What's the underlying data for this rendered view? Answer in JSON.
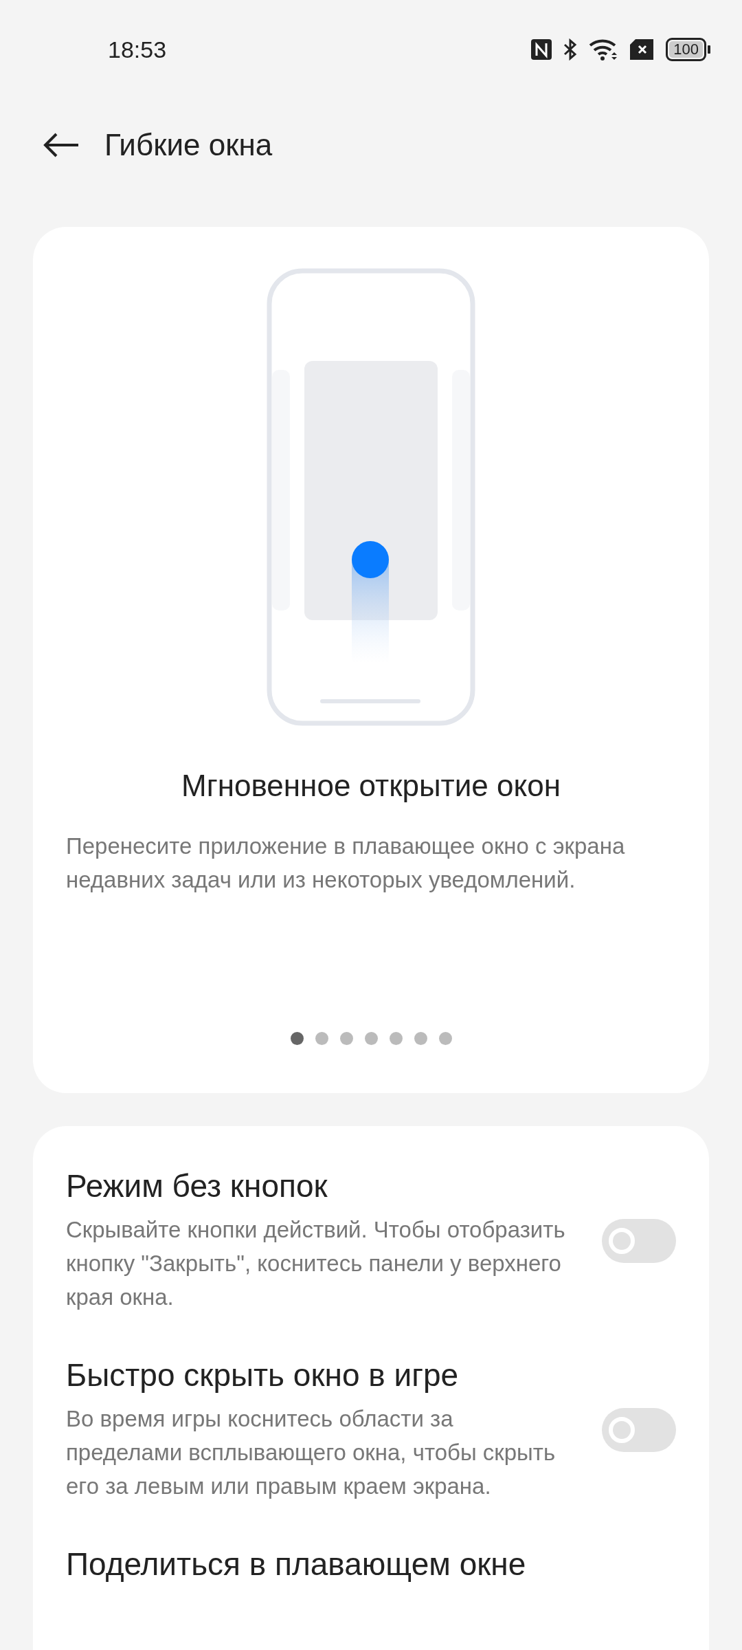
{
  "status_bar": {
    "time": "18:53",
    "battery": "100"
  },
  "header": {
    "title": "Гибкие окна"
  },
  "intro_card": {
    "heading": "Мгновенное открытие окон",
    "description": "Перенесите приложение в плавающее окно с экрана недавних задач или из некоторых уведомлений.",
    "pages": [
      {
        "selected": true
      },
      {
        "selected": false
      },
      {
        "selected": false
      },
      {
        "selected": false
      },
      {
        "selected": false
      },
      {
        "selected": false
      },
      {
        "selected": false
      }
    ]
  },
  "settings": [
    {
      "title": "Режим без кнопок",
      "description": "Скрывайте кнопки действий. Чтобы отобразить кнопку \"Закрыть\", коснитесь панели у верхнего края окна.",
      "on": false
    },
    {
      "title": "Быстро скрыть окно в игре",
      "description": "Во время игры коснитесь области за пределами всплывающего окна, чтобы скрыть его за левым или правым краем экрана.",
      "on": false
    },
    {
      "title": "Поделиться в плавающем окне"
    }
  ]
}
